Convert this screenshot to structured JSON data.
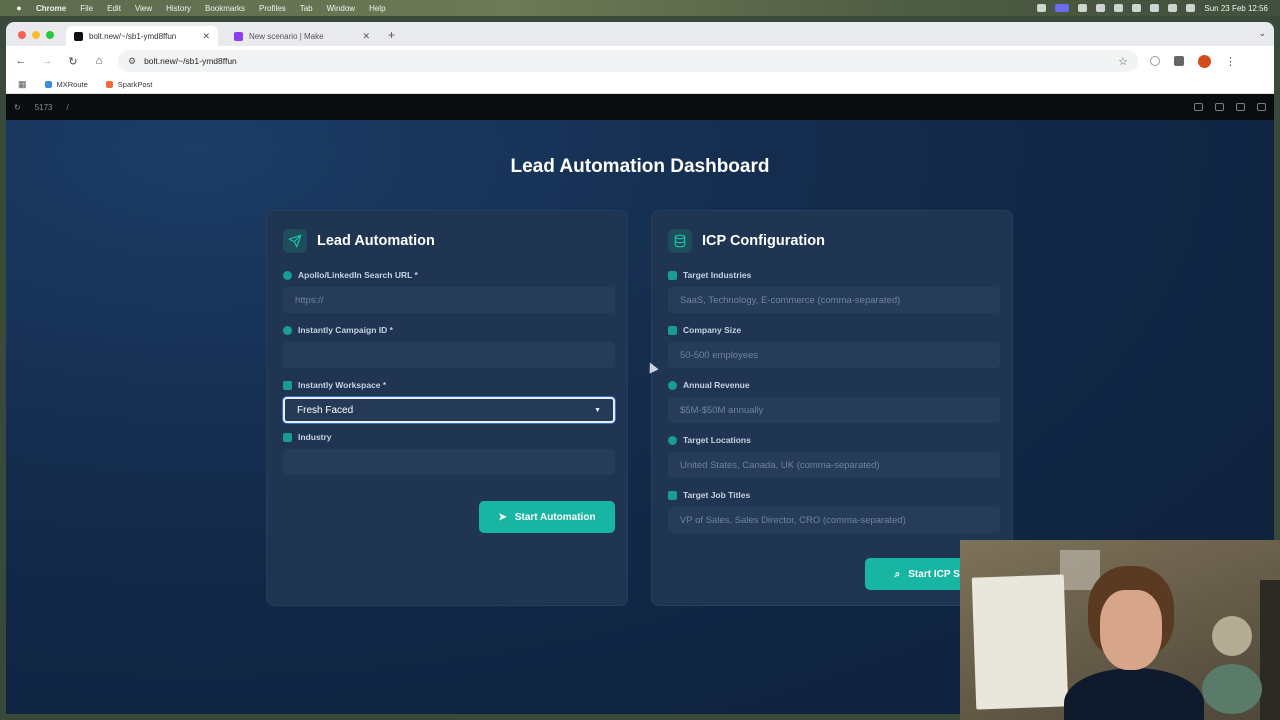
{
  "menubar": {
    "app": "Chrome",
    "items": [
      "File",
      "Edit",
      "View",
      "History",
      "Bookmarks",
      "Profiles",
      "Tab",
      "Window",
      "Help"
    ],
    "clock": "Sun 23 Feb 12:56"
  },
  "browser": {
    "tabs": [
      {
        "title": "bolt.new/~/sb1-ymd8ffun",
        "active": true
      },
      {
        "title": "New scenario | Make",
        "active": false
      }
    ],
    "url": "bolt.new/~/sb1-ymd8ffun",
    "bookmarks": [
      "MXRoute",
      "SparkPost"
    ]
  },
  "preview": {
    "port": "5173",
    "path": "/"
  },
  "dashboard": {
    "title": "Lead Automation Dashboard",
    "lead_card": {
      "title": "Lead Automation",
      "fields": [
        {
          "label": "Apollo/LinkedIn Search URL *",
          "placeholder": "https://",
          "value": ""
        },
        {
          "label": "Instantly Campaign ID *",
          "placeholder": "",
          "value": ""
        },
        {
          "label": "Instantly Workspace *",
          "value": "Fresh Faced"
        },
        {
          "label": "Industry",
          "placeholder": "",
          "value": ""
        }
      ],
      "button": "Start Automation"
    },
    "icp_card": {
      "title": "ICP Configuration",
      "fields": [
        {
          "label": "Target Industries",
          "placeholder": "SaaS, Technology, E-commerce (comma-separated)"
        },
        {
          "label": "Company Size",
          "placeholder": "50-500 employees"
        },
        {
          "label": "Annual Revenue",
          "placeholder": "$5M-$50M annually"
        },
        {
          "label": "Target Locations",
          "placeholder": "United States, Canada, UK (comma-separated)"
        },
        {
          "label": "Target Job Titles",
          "placeholder": "VP of Sales, Sales Director, CRO (comma-separated)"
        }
      ],
      "button": "Start ICP Se"
    }
  },
  "colors": {
    "accent": "#18b6a2",
    "card_bg": "#1f3552",
    "page_bg": "#132a4a"
  }
}
